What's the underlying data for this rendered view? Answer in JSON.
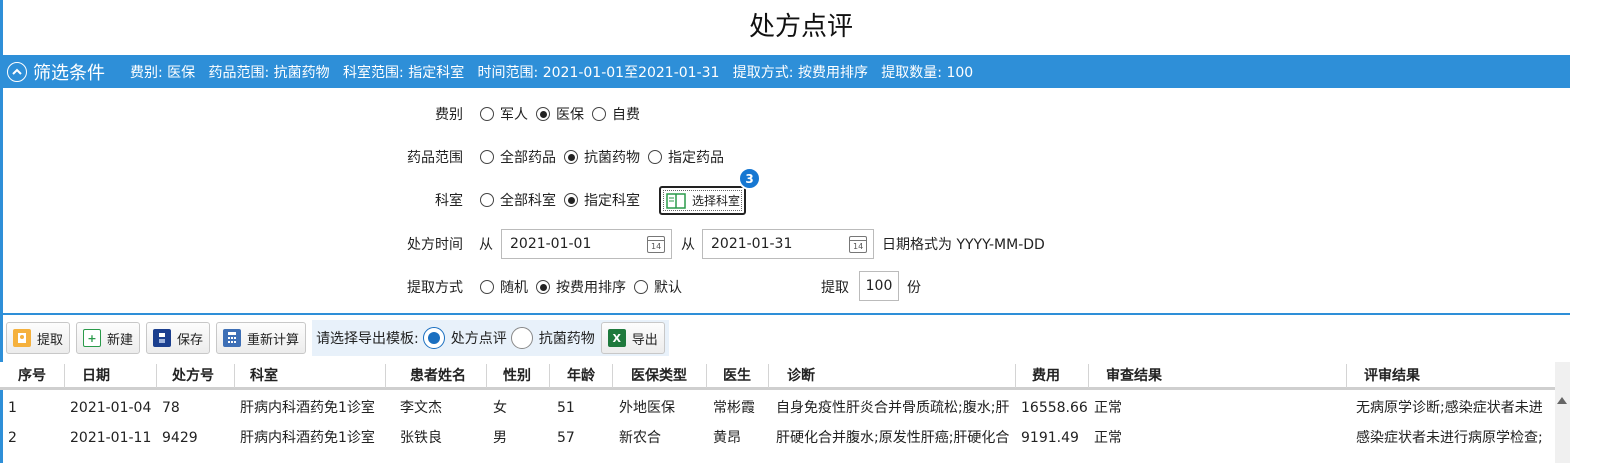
{
  "page": {
    "title": "处方点评"
  },
  "filter_bar": {
    "title": "筛选条件",
    "summary": "费别: 医保   药品范围: 抗菌药物   科室范围: 指定科室   时间范围: 2021-01-01至2021-01-31   提取方式: 按费用排序   提取数量: 100"
  },
  "form": {
    "fee_type": {
      "label": "费别",
      "options": [
        "军人",
        "医保",
        "自费"
      ],
      "selected": "医保"
    },
    "drug_scope": {
      "label": "药品范围",
      "options": [
        "全部药品",
        "抗菌药物",
        "指定药品"
      ],
      "selected": "抗菌药物"
    },
    "department": {
      "label": "科室",
      "options": [
        "全部科室",
        "指定科室"
      ],
      "selected": "指定科室",
      "select_button": "选择科室",
      "badge": "3"
    },
    "rx_time": {
      "label": "处方时间",
      "from_label": "从",
      "start": "2021-01-01",
      "to_label": "从",
      "end": "2021-01-31",
      "hint": "日期格式为 YYYY-MM-DD",
      "calendar_day": "14"
    },
    "extract_mode": {
      "label": "提取方式",
      "options": [
        "随机",
        "按费用排序",
        "默认"
      ],
      "selected": "按费用排序",
      "count_label": "提取",
      "count": "100",
      "unit": "份"
    }
  },
  "toolbar": {
    "extract": "提取",
    "new": "新建",
    "save": "保存",
    "recalc": "重新计算",
    "export_prompt": "请选择导出模板:",
    "template_options": [
      "处方点评",
      "抗菌药物"
    ],
    "template_selected": "处方点评",
    "export": "导出"
  },
  "table": {
    "columns": [
      "序号",
      "日期",
      "处方号",
      "科室",
      "患者姓名",
      "性别",
      "年龄",
      "医保类型",
      "医生",
      "诊断",
      "费用",
      "审查结果",
      "评审结果"
    ],
    "rows": [
      [
        "1",
        "2021-01-04",
        "78",
        "肝病内科酒药免1诊室",
        "李文杰",
        "女",
        "51",
        "外地医保",
        "常彬霞",
        "自身免疫性肝炎合并骨质疏松;腹水;肝",
        "16558.66",
        "正常",
        "无病原学诊断;感染症状者未进"
      ],
      [
        "2",
        "2021-01-11",
        "9429",
        "肝病内科酒药免1诊室",
        "张铁良",
        "男",
        "57",
        "新农合",
        "黄昂",
        "肝硬化合并腹水;原发性肝癌;肝硬化合",
        "9191.49",
        "正常",
        "感染症状者未进行病原学检查;"
      ]
    ]
  },
  "colors": {
    "accent": "#2e8fd8",
    "badge": "#1677d2"
  }
}
